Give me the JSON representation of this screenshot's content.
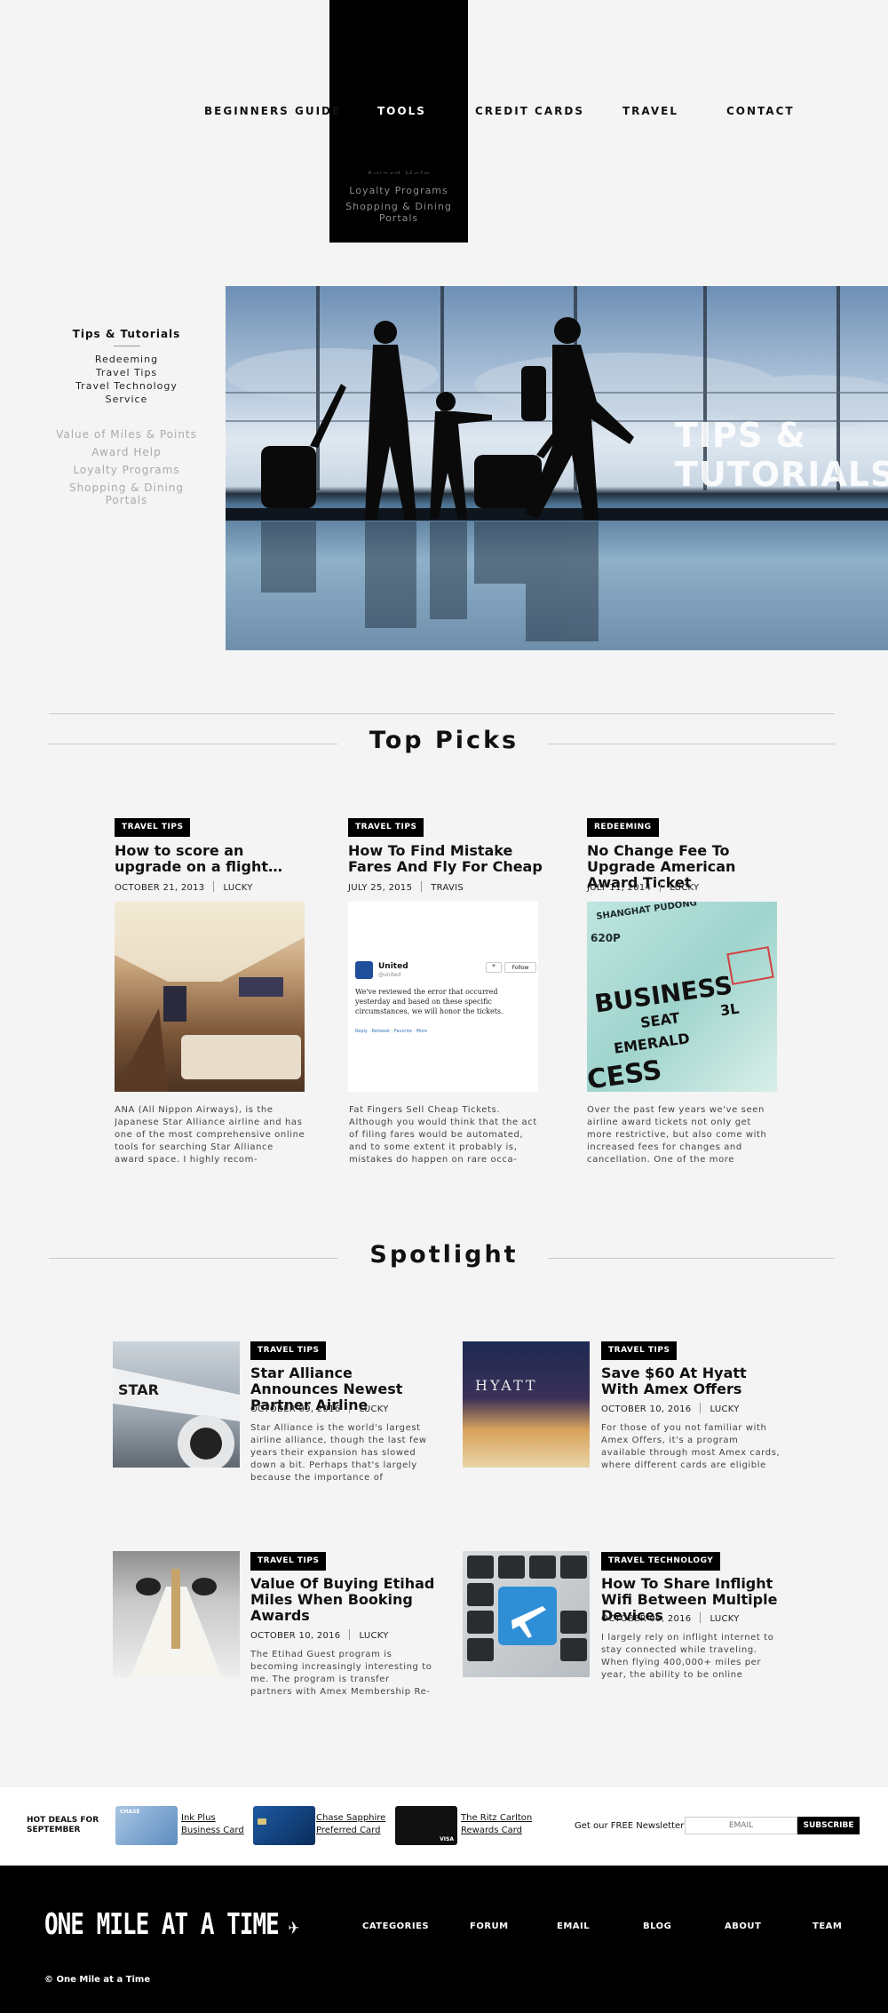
{
  "nav": {
    "items": [
      "BEGINNERS GUIDE",
      "TOOLS",
      "CREDIT CARDS",
      "TRAVEL",
      "CONTACT"
    ],
    "dropdown": [
      "Award Help",
      "Loyalty Programs",
      "Shopping & Dining Portals"
    ]
  },
  "sidebar": {
    "heading": "Tips & Tutorials",
    "items": [
      "Redeeming",
      "Travel Tips",
      "Travel Technology",
      "Service"
    ],
    "more": [
      "Value of Miles & Points",
      "Award Help",
      "Loyalty Programs",
      "Shopping & Dining Portals"
    ]
  },
  "hero": {
    "title_line1": "TIPS &",
    "title_line2": "TUTORIALS"
  },
  "top_picks": {
    "title": "Top Picks",
    "cards": [
      {
        "tag": "TRAVEL TIPS",
        "title": "How to score an upgrade on a flight…",
        "date": "OCTOBER 21, 2013",
        "author": "LUCKY",
        "excerpt": "ANA (All Nippon Airways), is the Japanese Star Alliance airline and has one of the most comprehensive online tools for searching Star Alliance award space. I highly recom-"
      },
      {
        "tag": "TRAVEL TIPS",
        "title": "How To Find Mistake Fares And Fly For Cheap",
        "date": "JULY 25, 2015",
        "author": "TRAVIS",
        "excerpt": "Fat Fingers Sell Cheap Tickets. Although you would think that the act of filing fares would be automated, and to some extent it probably is, mistakes do happen on rare occa-",
        "tweet": {
          "account": "United",
          "handle": "@united",
          "follow": "Follow",
          "body": "We've reviewed the error that occurred yesterday and based on these specific circumstances, we will honor the tickets.",
          "actions": [
            "Reply",
            "Retweet",
            "Favorite",
            "More"
          ]
        }
      },
      {
        "tag": "REDEEMING",
        "title": "No Change Fee To Upgrade American Award Ticket",
        "date": "JULY 11, 2014",
        "author": "LUCKY",
        "excerpt": "Over the past few years we've seen airline award tickets not only get more restrictive, but also come with increased fees for changes and cancellation. One of the more generous",
        "ticket": {
          "word1": "BUSINESS",
          "word2": "SEAT",
          "word3": "EMERALD",
          "word4": "CESS",
          "code": "3L",
          "city": "SHANGHAT PUDONG",
          "fl": "620P"
        }
      }
    ]
  },
  "spotlight": {
    "title": "Spotlight",
    "cards": [
      {
        "tag": "TRAVEL TIPS",
        "title": "Star Alliance Announces Newest Partner Airline",
        "date": "OCTOBER 09, 2016",
        "author": "LUCKY",
        "excerpt": "Star Alliance is the world's largest airline alliance, though the last few years their expansion has slowed down a bit. Perhaps that's largely because the importance of"
      },
      {
        "tag": "TRAVEL TIPS",
        "title": "Save $60 At Hyatt With Amex Offers",
        "date": "OCTOBER 10, 2016",
        "author": "LUCKY",
        "excerpt": "For those of you not familiar with Amex Offers, it's a program available through most Amex cards, where different cards are eligible",
        "sign": "HYATT"
      },
      {
        "tag": "TRAVEL TIPS",
        "title": "Value Of Buying Etihad Miles When Booking Awards",
        "date": "OCTOBER 10, 2016",
        "author": "LUCKY",
        "excerpt": "The Etihad Guest program is becoming increasingly interesting to me. The program is transfer partners with Amex Membership Re-"
      },
      {
        "tag": "TRAVEL TECHNOLOGY",
        "title": "How To Share Inflight Wifi Between Multiple Devices",
        "date": "OCTOBER 09, 2016",
        "author": "LUCKY",
        "excerpt": "I largely rely on inflight internet to stay connected while traveling. When flying 400,000+ miles per year, the ability to be online"
      }
    ]
  },
  "deals": {
    "label_line1": "HOT DEALS FOR",
    "label_line2": "SEPTEMBER",
    "cards": [
      {
        "line1": "Ink Plus",
        "line2": "Business Card",
        "color": "#7fa7d1",
        "brand": "CHASE"
      },
      {
        "line1": "Chase Sapphire",
        "line2": "Preferred Card",
        "color": "#0f3f7a",
        "brand": ""
      },
      {
        "line1": "The Ritz Carlton",
        "line2": "Rewards Card",
        "color": "#111111",
        "brand": "VISA"
      }
    ],
    "newsletter_label": "Get our FREE Newsletter",
    "email_placeholder": "EMAIL",
    "subscribe": "SUBSCRIBE"
  },
  "footer": {
    "logo": "ONE MILE AT A TIME",
    "links": [
      "CATEGORIES",
      "FORUM",
      "EMAIL",
      "BLOG",
      "ABOUT",
      "TEAM"
    ],
    "copyright": "© One Mile at a Time"
  }
}
